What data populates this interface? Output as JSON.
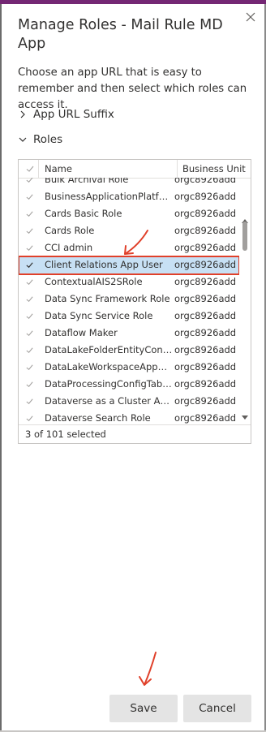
{
  "dialog": {
    "title": "Manage Roles - Mail Rule MD App",
    "description": "Choose an app URL that is easy to remember and then select which roles can access it.",
    "close_icon": "close-icon"
  },
  "sections": {
    "app_url_suffix": "App URL Suffix",
    "roles": "Roles"
  },
  "grid": {
    "columns": {
      "name": "Name",
      "business_unit": "Business Unit"
    },
    "rows": [
      {
        "name": "Bulk Archival Role",
        "business_unit": "orgc8926add",
        "selected": false
      },
      {
        "name": "BusinessApplicationPlatformR...",
        "business_unit": "orgc8926add",
        "selected": false
      },
      {
        "name": "Cards Basic Role",
        "business_unit": "orgc8926add",
        "selected": false
      },
      {
        "name": "Cards Role",
        "business_unit": "orgc8926add",
        "selected": false
      },
      {
        "name": "CCI admin",
        "business_unit": "orgc8926add",
        "selected": false
      },
      {
        "name": "Client Relations App User",
        "business_unit": "orgc8926add",
        "selected": true
      },
      {
        "name": "ContextualAIS2SRole",
        "business_unit": "orgc8926add",
        "selected": false
      },
      {
        "name": "Data Sync Framework Role",
        "business_unit": "orgc8926add",
        "selected": false
      },
      {
        "name": "Data Sync Service Role",
        "business_unit": "orgc8926add",
        "selected": false
      },
      {
        "name": "Dataflow Maker",
        "business_unit": "orgc8926add",
        "selected": false
      },
      {
        "name": "DataLakeFolderEntityContrib...",
        "business_unit": "orgc8926add",
        "selected": false
      },
      {
        "name": "DataLakeWorkspaceAppAccess",
        "business_unit": "orgc8926add",
        "selected": false
      },
      {
        "name": "DataProcessingConfigTableA...",
        "business_unit": "orgc8926add",
        "selected": false
      },
      {
        "name": "Dataverse as a Cluster App R...",
        "business_unit": "orgc8926add",
        "selected": false
      },
      {
        "name": "Dataverse Search Role",
        "business_unit": "orgc8926add",
        "selected": false
      }
    ],
    "footer": "3 of 101 selected"
  },
  "buttons": {
    "save": "Save",
    "cancel": "Cancel"
  },
  "colors": {
    "accent_bar": "#742774",
    "selected_row": "#c7e0f4",
    "annotation_red": "#e0402a"
  }
}
